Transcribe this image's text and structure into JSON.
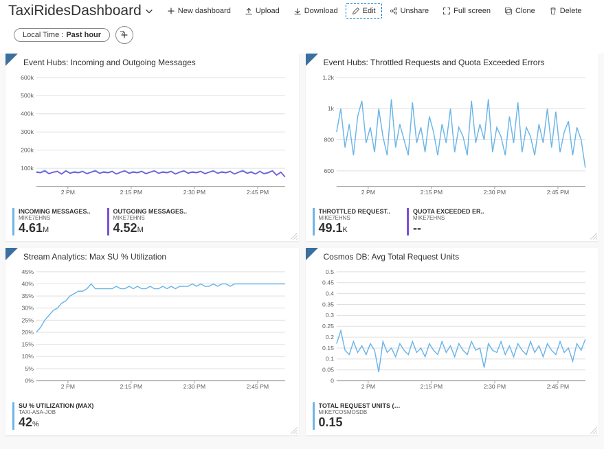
{
  "header": {
    "title": "TaxiRidesDashboard",
    "toolbar": {
      "new": "New dashboard",
      "upload": "Upload",
      "download": "Download",
      "edit": "Edit",
      "unshare": "Unshare",
      "fullscreen": "Full screen",
      "clone": "Clone",
      "delete": "Delete"
    }
  },
  "filters": {
    "time_label": "Local Time :",
    "time_value": "Past hour"
  },
  "charts": {
    "c1": {
      "title": "Event Hubs: Incoming and Outgoing Messages",
      "x_ticks": [
        "2 PM",
        "2:15 PM",
        "2:30 PM",
        "2:45 PM"
      ],
      "y_ticks": [
        "100k",
        "200k",
        "300k",
        "400k",
        "500k",
        "600k"
      ],
      "legend": [
        {
          "label": "INCOMING MESSAGES..",
          "sub": "MIKE7EHNS",
          "value": "4.61",
          "unit": "M",
          "color": "#6bb5e8"
        },
        {
          "label": "OUTGOING MESSAGES..",
          "sub": "MIKE7EHNS",
          "value": "4.52",
          "unit": "M",
          "color": "#7a4fd6"
        }
      ]
    },
    "c2": {
      "title": "Event Hubs: Throttled Requests and Quota Exceeded Errors",
      "x_ticks": [
        "2 PM",
        "2:15 PM",
        "2:30 PM",
        "2:45 PM"
      ],
      "y_ticks": [
        "600",
        "800",
        "1k",
        "1.2k"
      ],
      "legend": [
        {
          "label": "THROTTLED REQUEST..",
          "sub": "MIKE7EHNS",
          "value": "49.1",
          "unit": "K",
          "color": "#6bb5e8"
        },
        {
          "label": "QUOTA EXCEEDED ER..",
          "sub": "MIKE7EHNS",
          "value": "--",
          "unit": "",
          "color": "#7a4fd6"
        }
      ]
    },
    "c3": {
      "title": "Stream Analytics: Max SU % Utilization",
      "x_ticks": [
        "2 PM",
        "2:15 PM",
        "2:30 PM",
        "2:45 PM"
      ],
      "y_ticks": [
        "0%",
        "5%",
        "10%",
        "15%",
        "20%",
        "25%",
        "30%",
        "35%",
        "40%",
        "45%"
      ],
      "legend": [
        {
          "label": "SU % UTILIZATION (MAX)",
          "sub": "TAXI-ASA-JOB",
          "value": "42",
          "unit": "%",
          "color": "#6bb5e8"
        }
      ]
    },
    "c4": {
      "title": "Cosmos DB: Avg Total Request Units",
      "x_ticks": [
        "2 PM",
        "2:15 PM",
        "2:30 PM",
        "2:45 PM"
      ],
      "y_ticks": [
        "0",
        "0.05",
        "0.1",
        "0.15",
        "0.2",
        "0.25",
        "0.3",
        "0.35",
        "0.4",
        "0.45",
        "0.5"
      ],
      "legend": [
        {
          "label": "TOTAL REQUEST UNITS (AVG)",
          "sub": "MIKE7COSMOSDB",
          "value": "0.15",
          "unit": "",
          "color": "#6bb5e8"
        }
      ]
    }
  },
  "chart_data": [
    {
      "type": "line",
      "title": "Event Hubs: Incoming and Outgoing Messages",
      "xlabel": "",
      "ylabel": "",
      "ylim": [
        0,
        600000
      ],
      "x": [
        0,
        1,
        2,
        3,
        4,
        5,
        6,
        7,
        8,
        9,
        10,
        11,
        12,
        13,
        14,
        15,
        16,
        17,
        18,
        19,
        20,
        21,
        22,
        23,
        24,
        25,
        26,
        27,
        28,
        29,
        30,
        31,
        32,
        33,
        34,
        35,
        36,
        37,
        38,
        39,
        40,
        41,
        42,
        43,
        44,
        45,
        46,
        47,
        48,
        49,
        50,
        51,
        52,
        53,
        54,
        55,
        56,
        57,
        58,
        59
      ],
      "x_tick_labels": [
        "2 PM",
        "",
        "",
        "",
        "",
        "",
        "",
        "",
        "",
        "",
        "",
        "",
        "",
        "",
        "",
        "2:15 PM",
        "",
        "",
        "",
        "",
        "",
        "",
        "",
        "",
        "",
        "",
        "",
        "",
        "",
        "",
        "2:30 PM",
        "",
        "",
        "",
        "",
        "",
        "",
        "",
        "",
        "",
        "",
        "",
        "",
        "",
        "",
        "2:45 PM",
        "",
        "",
        "",
        "",
        "",
        "",
        "",
        "",
        "",
        "",
        "",
        "",
        "",
        ""
      ],
      "series": [
        {
          "name": "INCOMING MESSAGES (MIKE7EHNS)",
          "color": "#6bb5e8",
          "values": [
            82000,
            78000,
            90000,
            72000,
            80000,
            85000,
            70000,
            88000,
            75000,
            82000,
            78000,
            85000,
            72000,
            80000,
            90000,
            74000,
            82000,
            78000,
            85000,
            70000,
            80000,
            88000,
            75000,
            82000,
            78000,
            85000,
            72000,
            80000,
            88000,
            74000,
            82000,
            78000,
            85000,
            70000,
            80000,
            88000,
            75000,
            82000,
            78000,
            85000,
            72000,
            80000,
            88000,
            74000,
            82000,
            78000,
            85000,
            70000,
            80000,
            90000,
            75000,
            82000,
            70000,
            85000,
            72000,
            78000,
            88000,
            65000,
            80000,
            55000
          ]
        },
        {
          "name": "OUTGOING MESSAGES (MIKE7EHNS)",
          "color": "#7a4fd6",
          "values": [
            78000,
            75000,
            85000,
            70000,
            78000,
            82000,
            68000,
            85000,
            72000,
            78000,
            75000,
            82000,
            70000,
            78000,
            85000,
            72000,
            78000,
            75000,
            82000,
            68000,
            78000,
            85000,
            72000,
            78000,
            75000,
            82000,
            70000,
            78000,
            85000,
            72000,
            78000,
            75000,
            82000,
            68000,
            78000,
            85000,
            72000,
            78000,
            75000,
            82000,
            70000,
            78000,
            85000,
            72000,
            78000,
            75000,
            82000,
            68000,
            78000,
            85000,
            72000,
            78000,
            68000,
            82000,
            70000,
            75000,
            85000,
            62000,
            78000,
            52000
          ]
        }
      ]
    },
    {
      "type": "line",
      "title": "Event Hubs: Throttled Requests and Quota Exceeded Errors",
      "xlabel": "",
      "ylabel": "",
      "ylim": [
        500,
        1200
      ],
      "x": [
        0,
        1,
        2,
        3,
        4,
        5,
        6,
        7,
        8,
        9,
        10,
        11,
        12,
        13,
        14,
        15,
        16,
        17,
        18,
        19,
        20,
        21,
        22,
        23,
        24,
        25,
        26,
        27,
        28,
        29,
        30,
        31,
        32,
        33,
        34,
        35,
        36,
        37,
        38,
        39,
        40,
        41,
        42,
        43,
        44,
        45,
        46,
        47,
        48,
        49,
        50,
        51,
        52,
        53,
        54,
        55,
        56,
        57,
        58,
        59
      ],
      "x_tick_labels": [
        "2 PM",
        "",
        "",
        "",
        "",
        "",
        "",
        "",
        "",
        "",
        "",
        "",
        "",
        "",
        "",
        "2:15 PM",
        "",
        "",
        "",
        "",
        "",
        "",
        "",
        "",
        "",
        "",
        "",
        "",
        "",
        "",
        "2:30 PM",
        "",
        "",
        "",
        "",
        "",
        "",
        "",
        "",
        "",
        "",
        "",
        "",
        "",
        "",
        "2:45 PM",
        "",
        "",
        "",
        "",
        "",
        "",
        "",
        "",
        "",
        "",
        "",
        "",
        "",
        ""
      ],
      "series": [
        {
          "name": "THROTTLED REQUESTS (MIKE7EHNS)",
          "color": "#6bb5e8",
          "values": [
            850,
            1000,
            750,
            900,
            700,
            950,
            1050,
            780,
            880,
            720,
            1000,
            820,
            700,
            1060,
            750,
            900,
            800,
            700,
            1040,
            780,
            880,
            720,
            950,
            850,
            700,
            900,
            780,
            1000,
            720,
            880,
            820,
            700,
            1050,
            780,
            900,
            800,
            1060,
            720,
            880,
            820,
            700,
            950,
            780,
            1040,
            720,
            880,
            820,
            700,
            900,
            780,
            1000,
            750,
            980,
            720,
            850,
            920,
            700,
            880,
            800,
            620
          ]
        }
      ]
    },
    {
      "type": "line",
      "title": "Stream Analytics: Max SU % Utilization",
      "xlabel": "",
      "ylabel": "",
      "ylim": [
        0,
        45
      ],
      "x": [
        0,
        1,
        2,
        3,
        4,
        5,
        6,
        7,
        8,
        9,
        10,
        11,
        12,
        13,
        14,
        15,
        16,
        17,
        18,
        19,
        20,
        21,
        22,
        23,
        24,
        25,
        26,
        27,
        28,
        29,
        30,
        31,
        32,
        33,
        34,
        35,
        36,
        37,
        38,
        39,
        40,
        41,
        42,
        43,
        44,
        45,
        46,
        47,
        48,
        49,
        50,
        51,
        52,
        53,
        54,
        55,
        56,
        57,
        58,
        59
      ],
      "x_tick_labels": [
        "2 PM",
        "",
        "",
        "",
        "",
        "",
        "",
        "",
        "",
        "",
        "",
        "",
        "",
        "",
        "",
        "2:15 PM",
        "",
        "",
        "",
        "",
        "",
        "",
        "",
        "",
        "",
        "",
        "",
        "",
        "",
        "",
        "2:30 PM",
        "",
        "",
        "",
        "",
        "",
        "",
        "",
        "",
        "",
        "",
        "",
        "",
        "",
        "",
        "2:45 PM",
        "",
        "",
        "",
        "",
        "",
        "",
        "",
        "",
        "",
        "",
        "",
        "",
        "",
        ""
      ],
      "series": [
        {
          "name": "SU % UTILIZATION (MAX)",
          "color": "#6bb5e8",
          "values": [
            20,
            22,
            25,
            27,
            29,
            30,
            32,
            33,
            35,
            36,
            37,
            37,
            38,
            40,
            38,
            38,
            38,
            38,
            38,
            39,
            38,
            38,
            39,
            38,
            39,
            38,
            38,
            39,
            38,
            38,
            39,
            38,
            39,
            38,
            39,
            39,
            39,
            40,
            39,
            40,
            39,
            39,
            40,
            39,
            40,
            40,
            39,
            40,
            40,
            40,
            40,
            40,
            40,
            40,
            40,
            40,
            40,
            40,
            40,
            40
          ]
        }
      ]
    },
    {
      "type": "line",
      "title": "Cosmos DB: Avg Total Request Units",
      "xlabel": "",
      "ylabel": "",
      "ylim": [
        0,
        0.5
      ],
      "x": [
        0,
        1,
        2,
        3,
        4,
        5,
        6,
        7,
        8,
        9,
        10,
        11,
        12,
        13,
        14,
        15,
        16,
        17,
        18,
        19,
        20,
        21,
        22,
        23,
        24,
        25,
        26,
        27,
        28,
        29,
        30,
        31,
        32,
        33,
        34,
        35,
        36,
        37,
        38,
        39,
        40,
        41,
        42,
        43,
        44,
        45,
        46,
        47,
        48,
        49,
        50,
        51,
        52,
        53,
        54,
        55,
        56,
        57,
        58,
        59
      ],
      "x_tick_labels": [
        "2 PM",
        "",
        "",
        "",
        "",
        "",
        "",
        "",
        "",
        "",
        "",
        "",
        "",
        "",
        "",
        "2:15 PM",
        "",
        "",
        "",
        "",
        "",
        "",
        "",
        "",
        "",
        "",
        "",
        "",
        "",
        "",
        "2:30 PM",
        "",
        "",
        "",
        "",
        "",
        "",
        "",
        "",
        "",
        "",
        "",
        "",
        "",
        "",
        "2:45 PM",
        "",
        "",
        "",
        "",
        "",
        "",
        "",
        "",
        "",
        "",
        "",
        "",
        "",
        ""
      ],
      "series": [
        {
          "name": "TOTAL REQUEST UNITS (AVG)",
          "color": "#6bb5e8",
          "values": [
            0.17,
            0.23,
            0.14,
            0.12,
            0.18,
            0.13,
            0.16,
            0.12,
            0.17,
            0.14,
            0.04,
            0.18,
            0.13,
            0.15,
            0.11,
            0.17,
            0.14,
            0.12,
            0.18,
            0.13,
            0.15,
            0.11,
            0.17,
            0.14,
            0.12,
            0.18,
            0.13,
            0.16,
            0.11,
            0.17,
            0.14,
            0.12,
            0.18,
            0.14,
            0.15,
            0.06,
            0.17,
            0.14,
            0.13,
            0.18,
            0.12,
            0.16,
            0.11,
            0.17,
            0.14,
            0.12,
            0.18,
            0.13,
            0.16,
            0.11,
            0.17,
            0.14,
            0.12,
            0.18,
            0.13,
            0.15,
            0.09,
            0.17,
            0.14,
            0.19
          ]
        }
      ]
    }
  ]
}
